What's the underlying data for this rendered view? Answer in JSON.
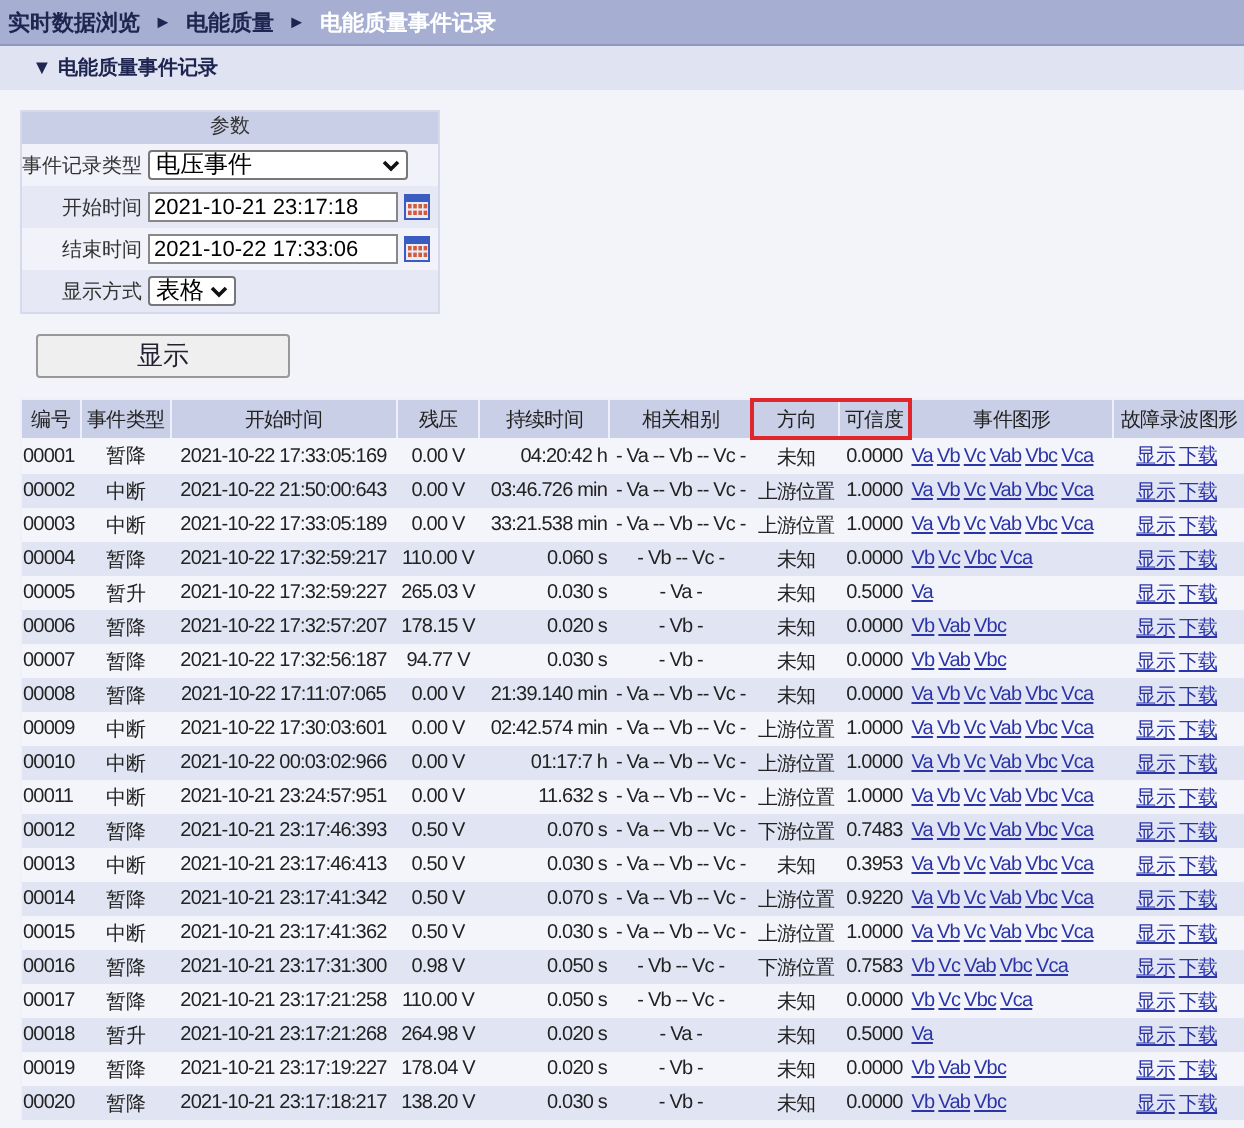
{
  "breadcrumb": [
    {
      "label": "实时数据浏览",
      "current": false
    },
    {
      "label": "电能质量",
      "current": false
    },
    {
      "label": "电能质量事件记录",
      "current": true
    }
  ],
  "breadcrumb_separator": "►",
  "section": {
    "toggle": "▼",
    "title": "电能质量事件记录"
  },
  "params": {
    "title": "参数",
    "fields": [
      {
        "kind": "select",
        "label": "事件记录类型",
        "value": "电压事件"
      },
      {
        "kind": "date",
        "label": "开始时间",
        "value": "2021-10-21 23:17:18"
      },
      {
        "kind": "date",
        "label": "结束时间",
        "value": "2021-10-22 17:33:06"
      },
      {
        "kind": "select_small",
        "label": "显示方式",
        "value": "表格"
      }
    ]
  },
  "show_button": "显示",
  "table": {
    "columns": [
      {
        "label": "编号",
        "highlighted": false
      },
      {
        "label": "事件类型",
        "highlighted": false
      },
      {
        "label": "开始时间",
        "highlighted": false
      },
      {
        "label": "残压",
        "highlighted": false
      },
      {
        "label": "持续时间",
        "highlighted": false
      },
      {
        "label": "相关相别",
        "highlighted": false
      },
      {
        "label": "方向",
        "highlighted": true
      },
      {
        "label": "可信度",
        "highlighted": true
      },
      {
        "label": "事件图形",
        "highlighted": false
      },
      {
        "label": "故障录波图形",
        "highlighted": false
      }
    ],
    "rows": [
      {
        "cells": [
          "00001",
          "暂降",
          "2021-10-22 17:33:05:169",
          "0.00 V",
          "04:20:42 h",
          "- Va -- Vb -- Vc -",
          "未知",
          "0.0000"
        ],
        "waveforms": [
          "Va",
          "Vb",
          "Vc",
          "Vab",
          "Vbc",
          "Vca"
        ],
        "fault_links": [
          "显示",
          "下载"
        ]
      },
      {
        "cells": [
          "00002",
          "中断",
          "2021-10-22 21:50:00:643",
          "0.00 V",
          "03:46.726 min",
          "- Va -- Vb -- Vc -",
          "上游位置",
          "1.0000"
        ],
        "waveforms": [
          "Va",
          "Vb",
          "Vc",
          "Vab",
          "Vbc",
          "Vca"
        ],
        "fault_links": [
          "显示",
          "下载"
        ]
      },
      {
        "cells": [
          "00003",
          "中断",
          "2021-10-22 17:33:05:189",
          "0.00 V",
          "33:21.538 min",
          "- Va -- Vb -- Vc -",
          "上游位置",
          "1.0000"
        ],
        "waveforms": [
          "Va",
          "Vb",
          "Vc",
          "Vab",
          "Vbc",
          "Vca"
        ],
        "fault_links": [
          "显示",
          "下载"
        ]
      },
      {
        "cells": [
          "00004",
          "暂降",
          "2021-10-22 17:32:59:217",
          "110.00 V",
          "0.060 s",
          "- Vb -- Vc -",
          "未知",
          "0.0000"
        ],
        "waveforms": [
          "Vb",
          "Vc",
          "Vbc",
          "Vca"
        ],
        "fault_links": [
          "显示",
          "下载"
        ]
      },
      {
        "cells": [
          "00005",
          "暂升",
          "2021-10-22 17:32:59:227",
          "265.03 V",
          "0.030 s",
          "- Va -",
          "未知",
          "0.5000"
        ],
        "waveforms": [
          "Va"
        ],
        "fault_links": [
          "显示",
          "下载"
        ]
      },
      {
        "cells": [
          "00006",
          "暂降",
          "2021-10-22 17:32:57:207",
          "178.15 V",
          "0.020 s",
          "- Vb -",
          "未知",
          "0.0000"
        ],
        "waveforms": [
          "Vb",
          "Vab",
          "Vbc"
        ],
        "fault_links": [
          "显示",
          "下载"
        ]
      },
      {
        "cells": [
          "00007",
          "暂降",
          "2021-10-22 17:32:56:187",
          "94.77 V",
          "0.030 s",
          "- Vb -",
          "未知",
          "0.0000"
        ],
        "waveforms": [
          "Vb",
          "Vab",
          "Vbc"
        ],
        "fault_links": [
          "显示",
          "下载"
        ]
      },
      {
        "cells": [
          "00008",
          "暂降",
          "2021-10-22 17:11:07:065",
          "0.00 V",
          "21:39.140 min",
          "- Va -- Vb -- Vc -",
          "未知",
          "0.0000"
        ],
        "waveforms": [
          "Va",
          "Vb",
          "Vc",
          "Vab",
          "Vbc",
          "Vca"
        ],
        "fault_links": [
          "显示",
          "下载"
        ]
      },
      {
        "cells": [
          "00009",
          "中断",
          "2021-10-22 17:30:03:601",
          "0.00 V",
          "02:42.574 min",
          "- Va -- Vb -- Vc -",
          "上游位置",
          "1.0000"
        ],
        "waveforms": [
          "Va",
          "Vb",
          "Vc",
          "Vab",
          "Vbc",
          "Vca"
        ],
        "fault_links": [
          "显示",
          "下载"
        ]
      },
      {
        "cells": [
          "00010",
          "中断",
          "2021-10-22 00:03:02:966",
          "0.00 V",
          "01:17:7 h",
          "- Va -- Vb -- Vc -",
          "上游位置",
          "1.0000"
        ],
        "waveforms": [
          "Va",
          "Vb",
          "Vc",
          "Vab",
          "Vbc",
          "Vca"
        ],
        "fault_links": [
          "显示",
          "下载"
        ]
      },
      {
        "cells": [
          "00011",
          "中断",
          "2021-10-21 23:24:57:951",
          "0.00 V",
          "11.632 s",
          "- Va -- Vb -- Vc -",
          "上游位置",
          "1.0000"
        ],
        "waveforms": [
          "Va",
          "Vb",
          "Vc",
          "Vab",
          "Vbc",
          "Vca"
        ],
        "fault_links": [
          "显示",
          "下载"
        ]
      },
      {
        "cells": [
          "00012",
          "暂降",
          "2021-10-21 23:17:46:393",
          "0.50 V",
          "0.070 s",
          "- Va -- Vb -- Vc -",
          "下游位置",
          "0.7483"
        ],
        "waveforms": [
          "Va",
          "Vb",
          "Vc",
          "Vab",
          "Vbc",
          "Vca"
        ],
        "fault_links": [
          "显示",
          "下载"
        ]
      },
      {
        "cells": [
          "00013",
          "中断",
          "2021-10-21 23:17:46:413",
          "0.50 V",
          "0.030 s",
          "- Va -- Vb -- Vc -",
          "未知",
          "0.3953"
        ],
        "waveforms": [
          "Va",
          "Vb",
          "Vc",
          "Vab",
          "Vbc",
          "Vca"
        ],
        "fault_links": [
          "显示",
          "下载"
        ]
      },
      {
        "cells": [
          "00014",
          "暂降",
          "2021-10-21 23:17:41:342",
          "0.50 V",
          "0.070 s",
          "- Va -- Vb -- Vc -",
          "上游位置",
          "0.9220"
        ],
        "waveforms": [
          "Va",
          "Vb",
          "Vc",
          "Vab",
          "Vbc",
          "Vca"
        ],
        "fault_links": [
          "显示",
          "下载"
        ]
      },
      {
        "cells": [
          "00015",
          "中断",
          "2021-10-21 23:17:41:362",
          "0.50 V",
          "0.030 s",
          "- Va -- Vb -- Vc -",
          "上游位置",
          "1.0000"
        ],
        "waveforms": [
          "Va",
          "Vb",
          "Vc",
          "Vab",
          "Vbc",
          "Vca"
        ],
        "fault_links": [
          "显示",
          "下载"
        ]
      },
      {
        "cells": [
          "00016",
          "暂降",
          "2021-10-21 23:17:31:300",
          "0.98 V",
          "0.050 s",
          "- Vb -- Vc -",
          "下游位置",
          "0.7583"
        ],
        "waveforms": [
          "Vb",
          "Vc",
          "Vab",
          "Vbc",
          "Vca"
        ],
        "fault_links": [
          "显示",
          "下载"
        ]
      },
      {
        "cells": [
          "00017",
          "暂降",
          "2021-10-21 23:17:21:258",
          "110.00 V",
          "0.050 s",
          "- Vb -- Vc -",
          "未知",
          "0.0000"
        ],
        "waveforms": [
          "Vb",
          "Vc",
          "Vbc",
          "Vca"
        ],
        "fault_links": [
          "显示",
          "下载"
        ]
      },
      {
        "cells": [
          "00018",
          "暂升",
          "2021-10-21 23:17:21:268",
          "264.98 V",
          "0.020 s",
          "- Va -",
          "未知",
          "0.5000"
        ],
        "waveforms": [
          "Va"
        ],
        "fault_links": [
          "显示",
          "下载"
        ]
      },
      {
        "cells": [
          "00019",
          "暂降",
          "2021-10-21 23:17:19:227",
          "178.04 V",
          "0.020 s",
          "- Vb -",
          "未知",
          "0.0000"
        ],
        "waveforms": [
          "Vb",
          "Vab",
          "Vbc"
        ],
        "fault_links": [
          "显示",
          "下载"
        ]
      },
      {
        "cells": [
          "00020",
          "暂降",
          "2021-10-21 23:17:18:217",
          "138.20 V",
          "0.030 s",
          "- Vb -",
          "未知",
          "0.0000"
        ],
        "waveforms": [
          "Vb",
          "Vab",
          "Vbc"
        ],
        "fault_links": [
          "显示",
          "下载"
        ]
      }
    ]
  }
}
